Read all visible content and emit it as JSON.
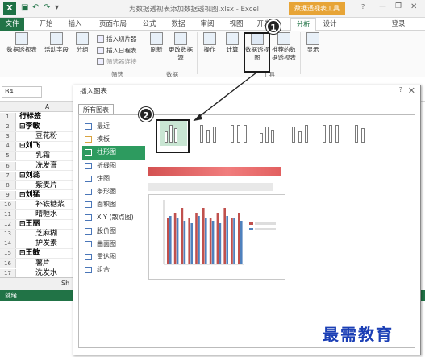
{
  "window": {
    "title": "为数据透视表添加数据透视图.xlsx - Excel",
    "tool_group": "数据透视表工具",
    "user": "登录"
  },
  "tabs": [
    "文件",
    "开始",
    "插入",
    "页面布局",
    "公式",
    "数据",
    "审阅",
    "视图",
    "开发",
    "分析",
    "设计"
  ],
  "ribbon": {
    "pivot_table": "数据透视表",
    "active_field": "活动字段",
    "group": "分组",
    "insert_slicer": "插入切片器",
    "insert_timeline": "插入日程表",
    "filter_connections": "筛选器连接",
    "filter_group": "筛选",
    "refresh": "刷新",
    "change_source": "更改数据源",
    "data_group": "数据",
    "actions": "操作",
    "calculations": "计算",
    "pivot_chart": "数据透视图",
    "recommended": "推荐的数据透视表",
    "tools_group": "工具",
    "show": "显示"
  },
  "namebox": "B4",
  "column_a": "A",
  "rows": [
    {
      "n": "1",
      "text": "行标签",
      "bold": true
    },
    {
      "n": "2",
      "text": "⊟李敏",
      "bold": true
    },
    {
      "n": "3",
      "text": "豆花粉",
      "bold": false,
      "indent": 20
    },
    {
      "n": "4",
      "text": "⊟刘飞",
      "bold": true
    },
    {
      "n": "5",
      "text": "乳霜",
      "bold": false,
      "indent": 20
    },
    {
      "n": "6",
      "text": "洗发膏",
      "bold": false,
      "indent": 20
    },
    {
      "n": "7",
      "text": "⊟刘蕊",
      "bold": true
    },
    {
      "n": "8",
      "text": "紫麦片",
      "bold": false,
      "indent": 20
    },
    {
      "n": "9",
      "text": "⊟刘猛",
      "bold": true
    },
    {
      "n": "10",
      "text": "补铁糖浆",
      "bold": false,
      "indent": 20
    },
    {
      "n": "11",
      "text": "晴喱水",
      "bold": false,
      "indent": 20
    },
    {
      "n": "12",
      "text": "⊟王丽",
      "bold": true
    },
    {
      "n": "13",
      "text": "芝麻糊",
      "bold": false,
      "indent": 20
    },
    {
      "n": "14",
      "text": "护发素",
      "bold": false,
      "indent": 20
    },
    {
      "n": "15",
      "text": "⊟王敏",
      "bold": true
    },
    {
      "n": "16",
      "text": "薯片",
      "bold": false,
      "indent": 20
    },
    {
      "n": "17",
      "text": "洗发水",
      "bold": false,
      "indent": 20
    }
  ],
  "sheet_tab": "Sh",
  "status": "就绪",
  "dialog": {
    "title": "插入图表",
    "help": "?",
    "close": "✕",
    "tab": "所有图表",
    "categories": [
      "最近",
      "模板",
      "柱形图",
      "折线图",
      "饼图",
      "条形图",
      "面积图",
      "X Y (散点图)",
      "股价图",
      "曲面图",
      "雷达图",
      "组合"
    ],
    "selected_category": "柱形图"
  },
  "callouts": [
    "1",
    "2"
  ],
  "watermark": "最需教育",
  "colors": {
    "excel_green": "#217346",
    "tool_orange": "#e7a436",
    "selection_green": "#2d9b5f"
  }
}
